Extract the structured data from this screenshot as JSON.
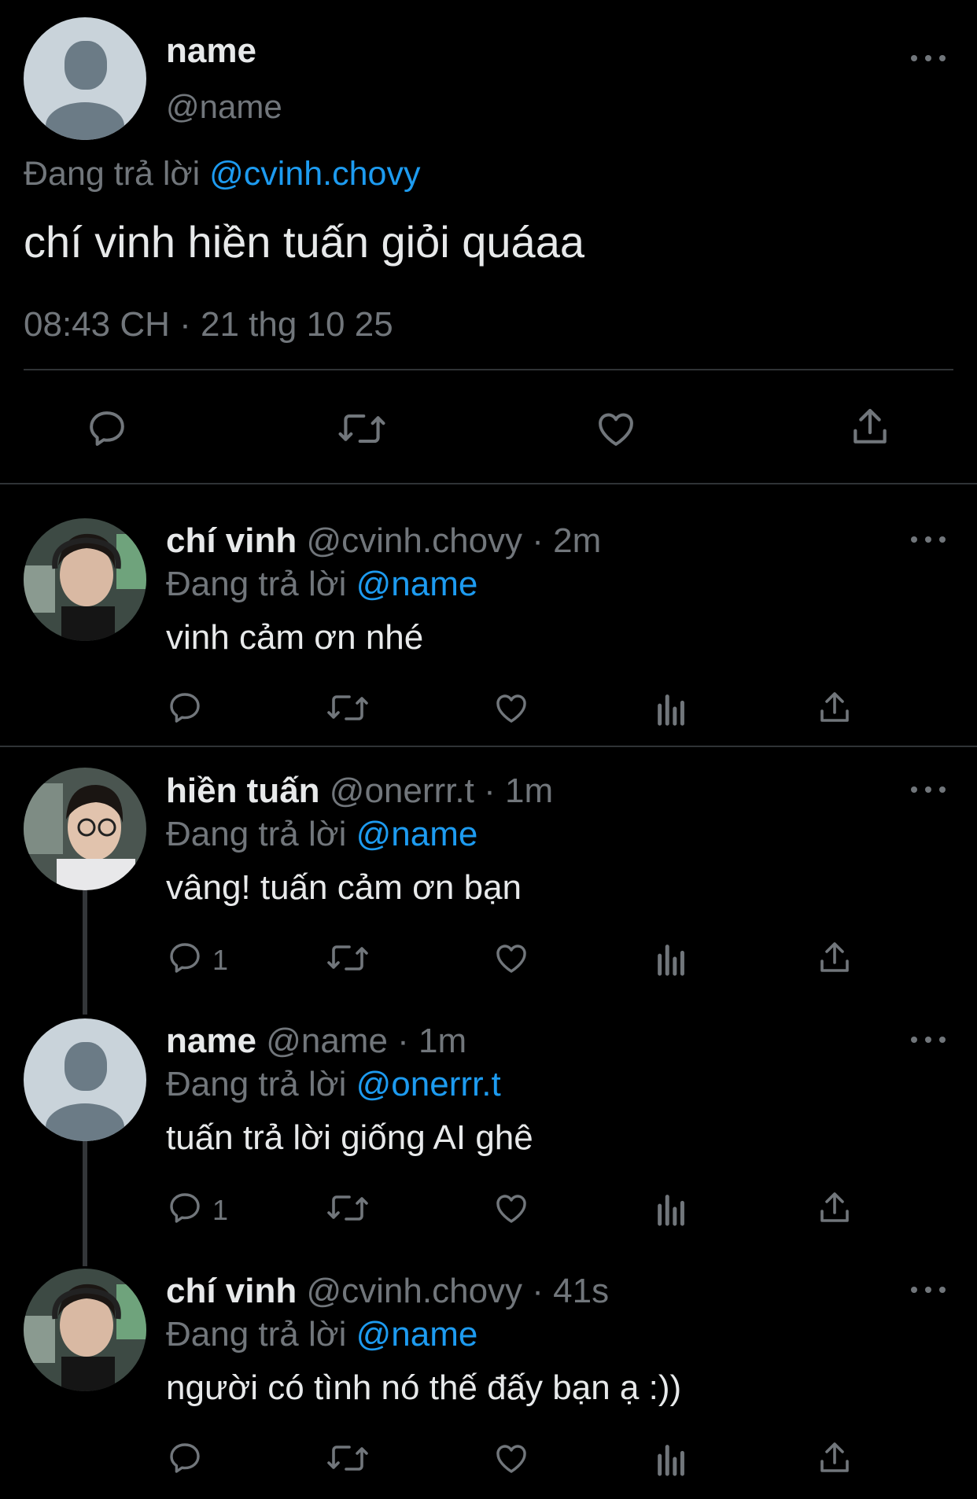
{
  "main_tweet": {
    "display_name": "name",
    "handle": "@name",
    "reply_prefix": "Đang trả lời",
    "reply_to": "@cvinh.chovy",
    "text": "chí vinh hiền tuấn giỏi quáaa",
    "time": "08:43 CH",
    "separator": "·",
    "date": "21 thg 10 25"
  },
  "replies": [
    {
      "display_name": "chí vinh",
      "handle": "@cvinh.chovy",
      "separator": "·",
      "age": "2m",
      "reply_prefix": "Đang trả lời",
      "reply_to": "@name",
      "text": "vinh cảm ơn nhé",
      "reply_count": ""
    },
    {
      "display_name": "hiền tuấn",
      "handle": "@onerrr.t",
      "separator": "·",
      "age": "1m",
      "reply_prefix": "Đang trả lời",
      "reply_to": "@name",
      "text": "vâng! tuấn cảm ơn bạn",
      "reply_count": "1"
    },
    {
      "display_name": "name",
      "handle": "@name",
      "separator": "·",
      "age": "1m",
      "reply_prefix": "Đang trả lời",
      "reply_to": "@onerrr.t",
      "text": "tuấn trả lời giống AI ghê",
      "reply_count": "1"
    },
    {
      "display_name": "chí vinh",
      "handle": "@cvinh.chovy",
      "separator": "·",
      "age": "41s",
      "reply_prefix": "Đang trả lời",
      "reply_to": "@name",
      "text": "người có tình nó thế đấy bạn ạ :))",
      "reply_count": ""
    }
  ],
  "colors": {
    "background": "#000000",
    "text": "#e7e9ea",
    "muted": "#71767b",
    "link": "#1d9bf0",
    "divider": "#2f3336"
  },
  "icons": [
    "reply-icon",
    "retweet-icon",
    "like-icon",
    "share-icon",
    "views-icon",
    "more-icon"
  ]
}
